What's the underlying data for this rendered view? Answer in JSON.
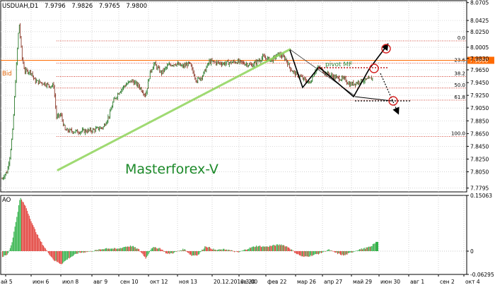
{
  "chart_data": {
    "type": "ohlc",
    "symbol_header": {
      "symbol": "USDUAH,D1",
      "values": [
        "7.9796",
        "7.9826",
        "7.9765",
        "7.9800"
      ]
    },
    "watermark": "Masterforex-V",
    "main_axis": {
      "ylim": [
        7.7735,
        8.0735
      ],
      "ticks": [
        "8.0705",
        "8.0425",
        "8.0250",
        "8.0005",
        "7.9830",
        "7.9650",
        "7.9450",
        "7.9250",
        "7.9050",
        "7.8850",
        "7.8650",
        "7.8450",
        "7.8250",
        "7.8050",
        "7.7795"
      ],
      "tick_values": [
        8.0705,
        8.0425,
        8.025,
        8.0005,
        7.983,
        7.965,
        7.945,
        7.925,
        7.905,
        7.885,
        7.865,
        7.845,
        7.825,
        7.805,
        7.7795
      ]
    },
    "bid": {
      "label": "Bid",
      "price": 7.98,
      "price_label": "7.9800",
      "color": "#ff6a00"
    },
    "fibonacci": {
      "levels": [
        {
          "label": "0.0",
          "price": 8.0105
        },
        {
          "label": "23.6",
          "price": 7.9755
        },
        {
          "label": "38.2",
          "price": 7.9545
        },
        {
          "label": "50.0",
          "price": 7.9365
        },
        {
          "label": "61.8",
          "price": 7.9175
        },
        {
          "label": "100.0",
          "price": 7.8605
        }
      ],
      "color": "#d0392b"
    },
    "annotations": [
      {
        "text": "pivot MF",
        "color": "#2e8b3a"
      }
    ],
    "ao_panel": {
      "label": "AO",
      "ylim": [
        -0.06295,
        0.15063
      ],
      "ticks": [
        "0.15063",
        "0",
        "-0.06295"
      ],
      "tick_values": [
        0.15063,
        0,
        -0.06295
      ],
      "up_color": "#32b24a",
      "down_color": "#e2403a"
    },
    "x_axis": {
      "tick_labels": [
        "ай 5",
        "июн 6",
        "июл 8",
        "авг 9",
        "сен 10",
        "окт 12",
        "ноя 13",
        "20.12.2010 3:00",
        "кв 20",
        "фев 22",
        "мар 26",
        "апр 27",
        "май 29",
        "июн 30",
        "авг 1",
        "сен 2",
        "окт 4"
      ]
    },
    "grid": true,
    "colors": {
      "bull_bar": "#2b7a2b",
      "bear_bar": "#8a3a2a",
      "trendline": "#8fd45a",
      "pattern_line": "#000000"
    }
  }
}
